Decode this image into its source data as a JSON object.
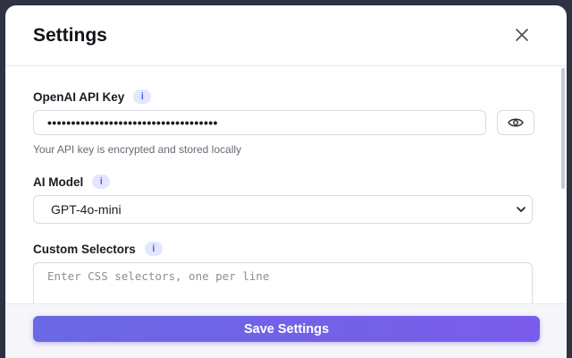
{
  "modal": {
    "title": "Settings"
  },
  "api_key": {
    "label": "OpenAI API Key",
    "info_icon_text": "i",
    "value": "••••••••••••••••••••••••••••••••••••",
    "helper": "Your API key is encrypted and stored locally"
  },
  "model": {
    "label": "AI Model",
    "info_icon_text": "i",
    "selected": "GPT-4o-mini"
  },
  "selectors": {
    "label": "Custom Selectors",
    "info_icon_text": "i",
    "placeholder": "Enter CSS selectors, one per line"
  },
  "footer": {
    "save_label": "Save Settings"
  },
  "colors": {
    "accent_start": "#6a68e4",
    "accent_end": "#7a5cea",
    "info_badge_bg": "#e3e6ff",
    "info_badge_fg": "#5461e6"
  },
  "icons": {
    "close": "close-icon",
    "eye": "eye-icon",
    "chevron": "chevron-down-icon",
    "info": "info-icon"
  }
}
